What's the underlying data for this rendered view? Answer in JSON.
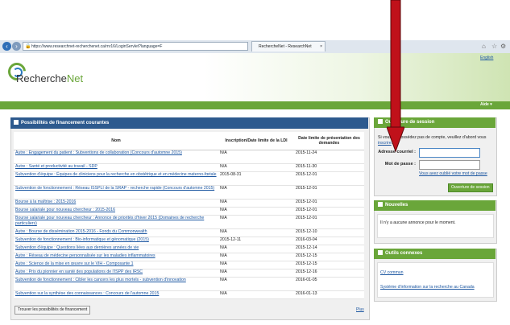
{
  "browser": {
    "url": "https://www.researchnet-recherchenet.ca/rnr16/LoginServlet?language=F",
    "tab_title": "RechercheNet - ResearchNet",
    "back_icon": "back-icon",
    "forward_icon": "forward-icon"
  },
  "header": {
    "logo_part1": "Recherche",
    "logo_part2": "Net",
    "language_link": "English",
    "help_label": "Aide ▾"
  },
  "funding": {
    "title": "Possibilités de financement courantes",
    "columns": [
      "Nom",
      "Inscription/Date limite de la LDI",
      "Date limite de présentation des demandes"
    ],
    "rows": [
      {
        "name": "Autre : Engagement du patient : Subventions de collaboration (Concours d'automne 2015)",
        "ldi": "N/A",
        "deadline": "2015-11-24"
      },
      {
        "name": "Autre : Santé et productivité au travail - SDP",
        "ldi": "N/A",
        "deadline": "2015-11-30"
      },
      {
        "name": "Subvention d'équipe : Équipes de cliniciens pour la recherche en obstétrique et en médecine materno-fœtale",
        "ldi": "2015-08-31",
        "deadline": "2015-12-01"
      },
      {
        "name": "Subvention de fonctionnement : Réseau ISSPLI de la SRAP - recherche rapide (Concours d'automne 2015)",
        "ldi": "N/A",
        "deadline": "2015-12-01"
      },
      {
        "name": "Bourse à la maîtrise : 2015-2016",
        "ldi": "N/A",
        "deadline": "2015-12-01"
      },
      {
        "name": "Bourse salariale pour nouveau chercheur : 2015-2016",
        "ldi": "N/A",
        "deadline": "2015-12-01"
      },
      {
        "name": "Bourse salariale pour nouveau chercheur : Annonce de priorités d'hiver 2015 (Domaines de recherche particuliers)",
        "ldi": "N/A",
        "deadline": "2015-12-01"
      },
      {
        "name": "Autre : Bourse de dissémination 2015-2016 - Fonds du Commonwealth",
        "ldi": "N/A",
        "deadline": "2015-12-10"
      },
      {
        "name": "Subvention de fonctionnement : Bio-informatique et génomatique (2015)",
        "ldi": "2015-12-11",
        "deadline": "2016-03-04"
      },
      {
        "name": "Subvention d'équipe : Questions liées aux dernières années de vie",
        "ldi": "N/A",
        "deadline": "2015-12-14"
      },
      {
        "name": "Autre : Réseau de médecine personnalisée sur les maladies inflammatoires",
        "ldi": "N/A",
        "deadline": "2015-12-15"
      },
      {
        "name": "Autre : Science de la mise en œuvre sur le VIH - Composante 1",
        "ldi": "N/A",
        "deadline": "2015-12-15"
      },
      {
        "name": "Autre : Prix du pionnier en santé des populations de l'ISPP des IRSC",
        "ldi": "N/A",
        "deadline": "2015-12-16"
      },
      {
        "name": "Subvention de fonctionnement : Cibler les cancers les plus mortels - subvention d'innovation",
        "ldi": "N/A",
        "deadline": "2016-01-05"
      },
      {
        "name": "Subvention sur la synthèse des connaissances : Concours de l'automne 2015",
        "ldi": "N/A",
        "deadline": "2016-01-13"
      }
    ],
    "find_button": "Trouver les possibilités de financement",
    "more_link": "Plus"
  },
  "login": {
    "title": "Ouverture de session",
    "intro": "Si vous ne possédez pas de compte, veuillez d'abord vous",
    "register_link": "inscrire",
    "email_label": "Adresse courriel :",
    "email_value": "",
    "password_label": "Mot de passe :",
    "password_value": "",
    "forgot_link": "Vous avez oublié votre mot de passe",
    "login_button": "Ouverture de session"
  },
  "news": {
    "title": "Nouvelles",
    "message": "Il n'y a aucune annonce pour le moment."
  },
  "tools": {
    "title": "Outils connexes",
    "links": [
      "CV commun",
      "Système d'information sur la recherche au Canada"
    ]
  },
  "colors": {
    "green": "#6aa63a",
    "blue": "#2d5a8e",
    "arrow": "#c0111a"
  }
}
